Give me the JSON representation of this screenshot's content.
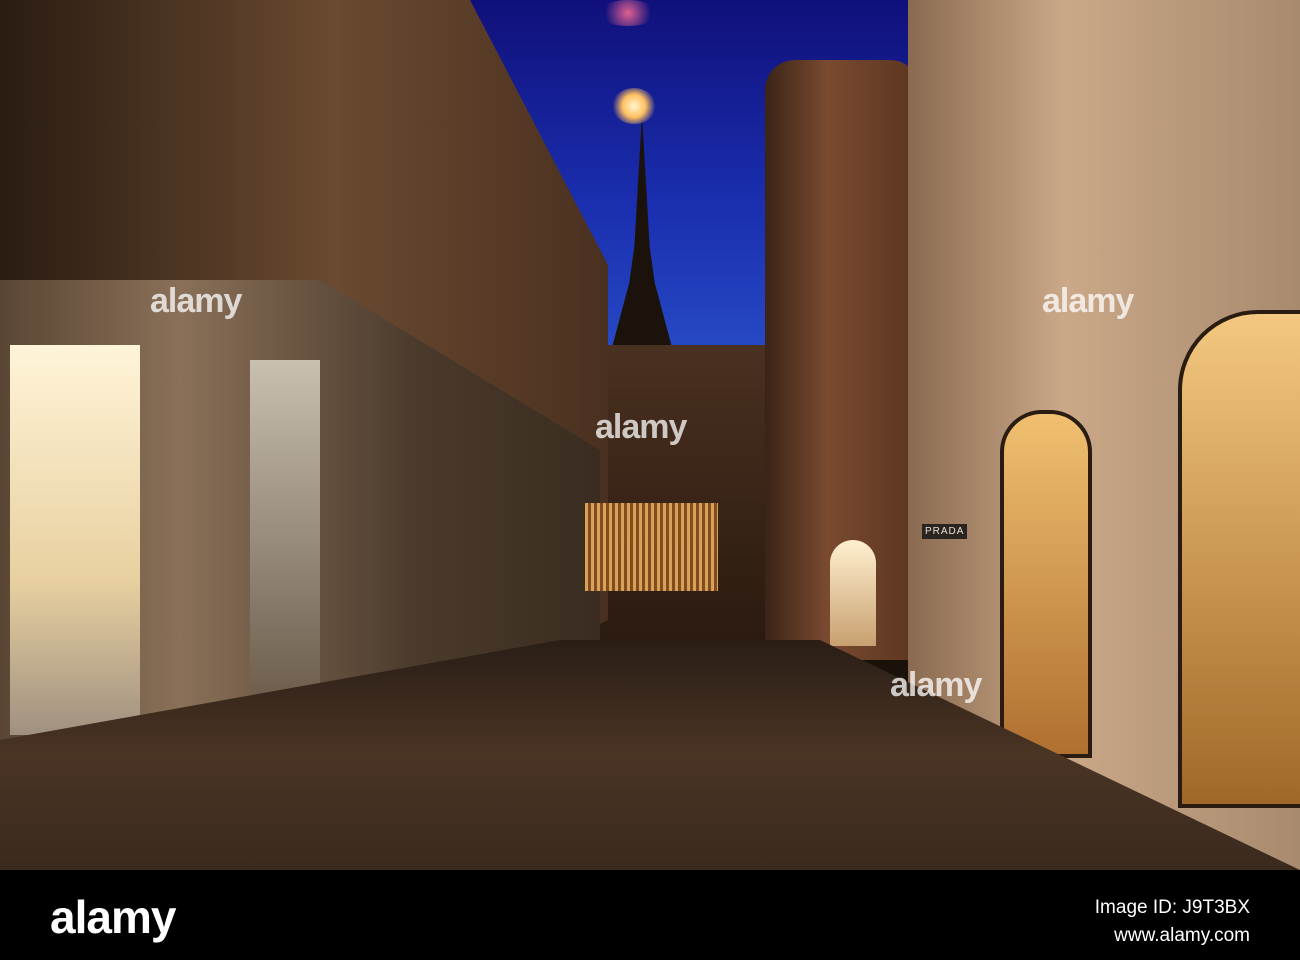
{
  "photo": {
    "description_sign": "PRADA",
    "watermark": "alamy"
  },
  "footer": {
    "logo": "alamy",
    "image_id": "Image ID: J9T3BX",
    "url": "www.alamy.com"
  }
}
